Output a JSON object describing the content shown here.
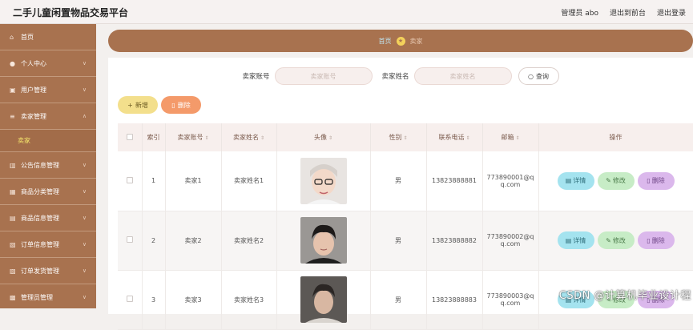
{
  "app": {
    "title": "二手儿童闲置物品交易平台"
  },
  "topbar": {
    "admin_label": "管理员 abo",
    "front_link": "退出到前台",
    "logout": "退出登录"
  },
  "sidebar": {
    "items": [
      {
        "label": "首页",
        "icon": "home-icon",
        "expandable": false
      },
      {
        "label": "个人中心",
        "icon": "user-icon",
        "expandable": true
      },
      {
        "label": "用户管理",
        "icon": "users-icon",
        "expandable": true
      },
      {
        "label": "卖家管理",
        "icon": "list-icon",
        "expandable": true
      },
      {
        "label": "公告信息管理",
        "icon": "chart-icon",
        "expandable": true
      },
      {
        "label": "商品分类管理",
        "icon": "grid-icon",
        "expandable": true
      },
      {
        "label": "商品信息管理",
        "icon": "box-icon",
        "expandable": true
      },
      {
        "label": "订单信息管理",
        "icon": "order-icon",
        "expandable": true
      },
      {
        "label": "订单发货管理",
        "icon": "shipping-icon",
        "expandable": true
      },
      {
        "label": "管理员管理",
        "icon": "admin-icon",
        "expandable": true
      }
    ],
    "active_sub": "卖家"
  },
  "breadcrumb": {
    "home": "首页",
    "current": "卖家"
  },
  "search": {
    "account_label": "卖家账号",
    "account_placeholder": "卖家账号",
    "name_label": "卖家姓名",
    "name_placeholder": "卖家姓名",
    "button": "查询"
  },
  "actions": {
    "add": "新增",
    "delete": "删除"
  },
  "table": {
    "columns": [
      "索引",
      "卖家账号",
      "卖家姓名",
      "头像",
      "性别",
      "联系电话",
      "邮箱",
      "操作"
    ],
    "rows": [
      {
        "index": "1",
        "account": "卖家1",
        "name": "卖家姓名1",
        "gender": "男",
        "phone": "13823888881",
        "email_line1": "773890001@q",
        "email_line2": "q.com"
      },
      {
        "index": "2",
        "account": "卖家2",
        "name": "卖家姓名2",
        "gender": "男",
        "phone": "13823888882",
        "email_line1": "773890002@q",
        "email_line2": "q.com"
      },
      {
        "index": "3",
        "account": "卖家3",
        "name": "卖家姓名3",
        "gender": "男",
        "phone": "13823888883",
        "email_line1": "773890003@q",
        "email_line2": "q.com"
      }
    ],
    "row_actions": {
      "detail": "详情",
      "edit": "修改",
      "delete": "删除"
    }
  },
  "watermark": "CSDN @计算机毕业设计程",
  "colors": {
    "sidebar": "#a8724f",
    "accent_yellow": "#f5e66b",
    "add_btn": "#f3df8c",
    "delete_btn": "#f49a6a",
    "detail_btn": "#a4e3ef",
    "edit_btn": "#c7ecc6",
    "row_delete_btn": "#dbb8ec"
  }
}
